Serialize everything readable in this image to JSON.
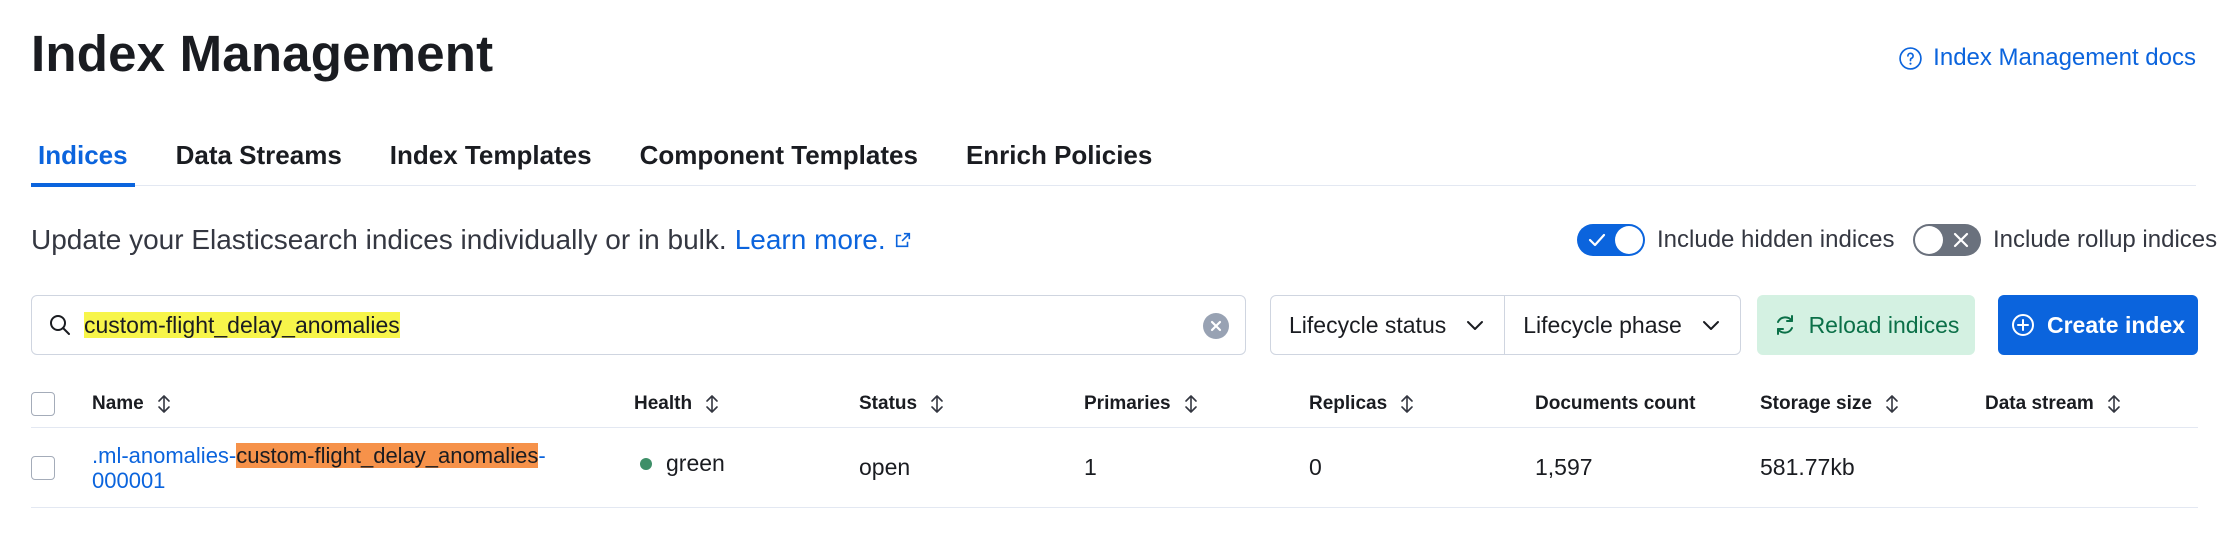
{
  "header": {
    "title": "Index Management",
    "docs_link": "Index Management docs"
  },
  "tabs": [
    {
      "label": "Indices",
      "active": true
    },
    {
      "label": "Data Streams",
      "active": false
    },
    {
      "label": "Index Templates",
      "active": false
    },
    {
      "label": "Component Templates",
      "active": false
    },
    {
      "label": "Enrich Policies",
      "active": false
    }
  ],
  "description": {
    "text": "Update your Elasticsearch indices individually or in bulk.",
    "learn_more": "Learn more."
  },
  "toggles": {
    "hidden": {
      "label": "Include hidden indices",
      "on": true
    },
    "rollup": {
      "label": "Include rollup indices",
      "on": false
    }
  },
  "search": {
    "value": "custom-flight_delay_anomalies"
  },
  "filters": {
    "lifecycle_status": "Lifecycle status",
    "lifecycle_phase": "Lifecycle phase"
  },
  "buttons": {
    "reload": "Reload indices",
    "create": "Create index"
  },
  "table": {
    "columns": [
      "Name",
      "Health",
      "Status",
      "Primaries",
      "Replicas",
      "Documents count",
      "Storage size",
      "Data stream"
    ],
    "rows": [
      {
        "name_prefix": ".ml-anomalies-",
        "name_match": "custom-flight_delay_anomalies",
        "name_suffix": "-",
        "name_line2": "000001",
        "health": "green",
        "status": "open",
        "primaries": "1",
        "replicas": "0",
        "documents_count": "1,597",
        "storage_size": "581.77kb",
        "data_stream": ""
      }
    ]
  },
  "colors": {
    "accent": "#0b64dd",
    "health_green": "#3e8f68",
    "search_highlight": "#f7f54a",
    "name_highlight": "#f6924a"
  }
}
